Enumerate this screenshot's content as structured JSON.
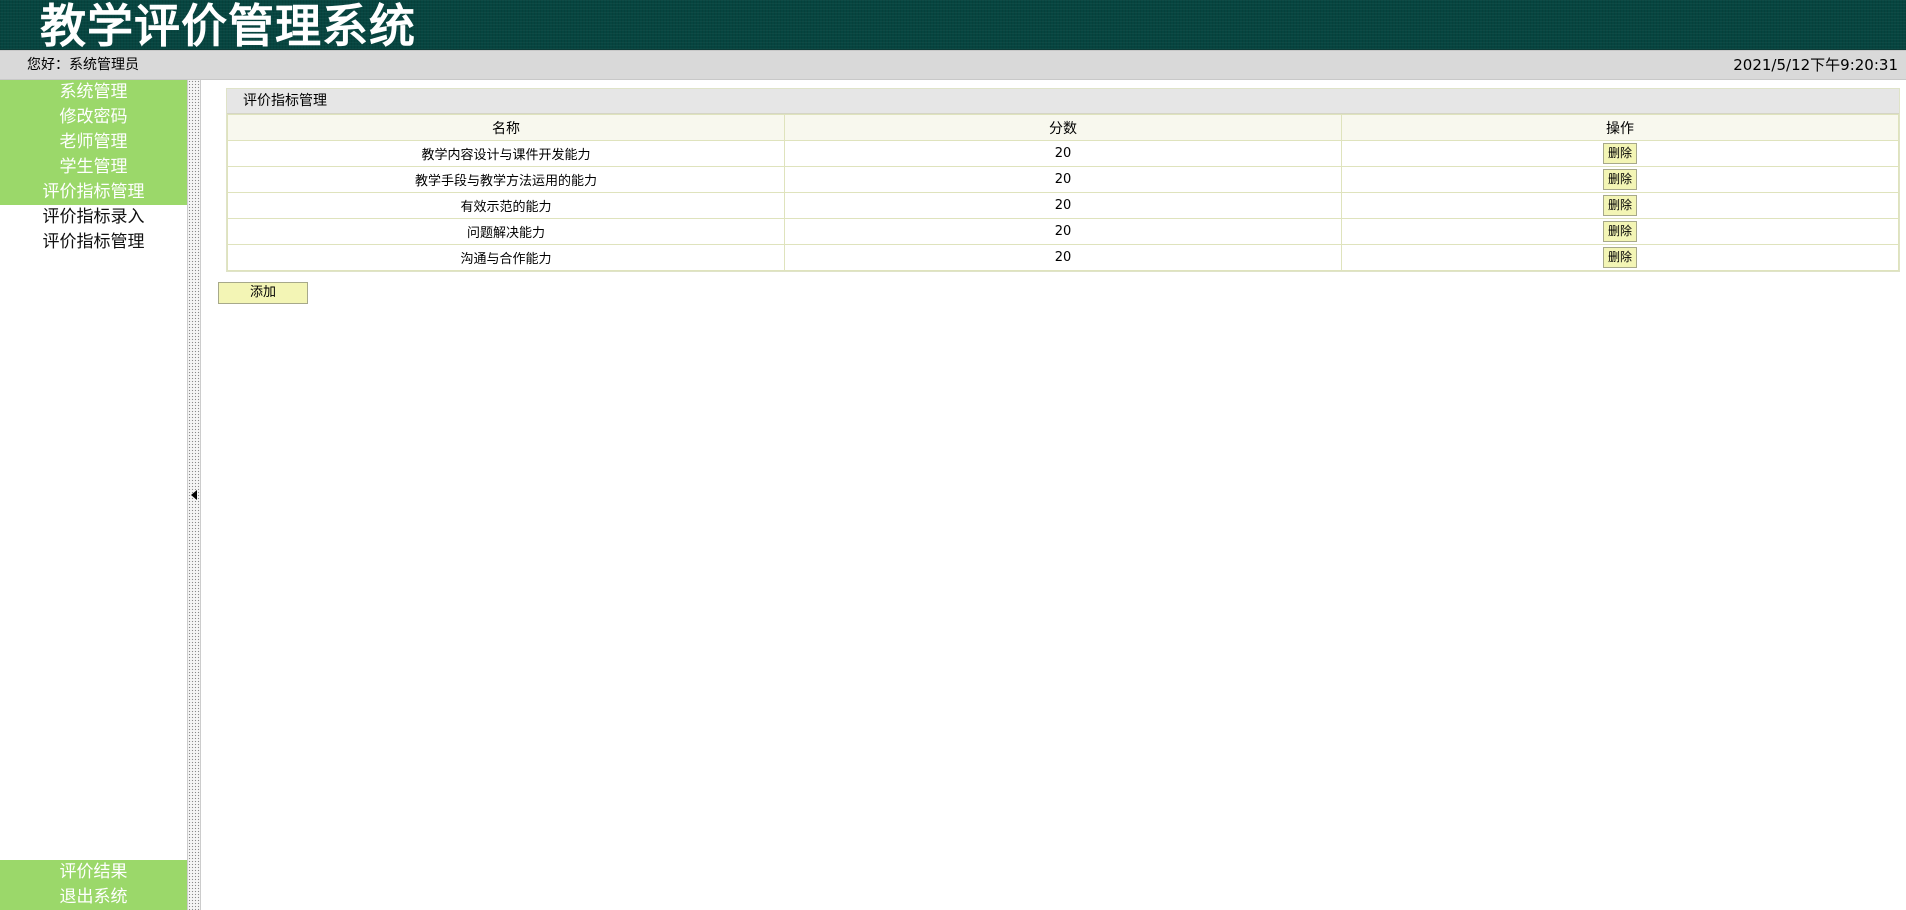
{
  "app": {
    "title": "教学评价管理系统"
  },
  "topbar": {
    "greeting": "您好：系统管理员",
    "datetime": "2021/5/12下午9:20:31"
  },
  "sidebar": {
    "items": [
      {
        "label": "系统管理"
      },
      {
        "label": "修改密码"
      },
      {
        "label": "老师管理"
      },
      {
        "label": "学生管理"
      },
      {
        "label": "评价指标管理"
      },
      {
        "label": "评价指标录入"
      },
      {
        "label": "评价指标管理"
      }
    ],
    "bottom_items": [
      {
        "label": "评价结果"
      },
      {
        "label": "退出系统"
      }
    ]
  },
  "main": {
    "panel_title": "评价指标管理",
    "columns": [
      "名称",
      "分数",
      "操作"
    ],
    "rows": [
      {
        "name": "教学内容设计与课件开发能力",
        "score": "20",
        "action": "删除"
      },
      {
        "name": "教学手段与教学方法运用的能力",
        "score": "20",
        "action": "删除"
      },
      {
        "name": "有效示范的能力",
        "score": "20",
        "action": "删除"
      },
      {
        "name": "问题解决能力",
        "score": "20",
        "action": "删除"
      },
      {
        "name": "沟通与合作能力",
        "score": "20",
        "action": "删除"
      }
    ],
    "add_label": "添加"
  },
  "colors": {
    "header_bg": "#064540",
    "nav_green": "#9bd86a",
    "button_bg": "#f3f5b5"
  }
}
